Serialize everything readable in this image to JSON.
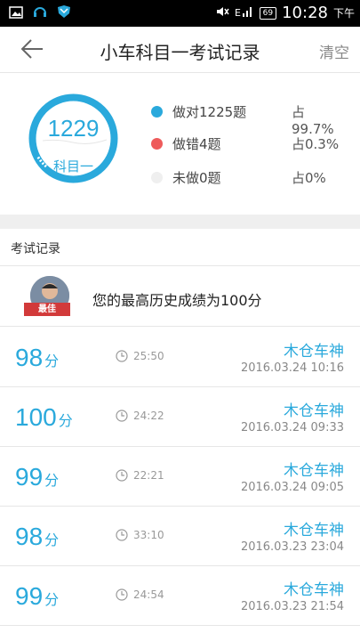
{
  "status_bar": {
    "battery": "69",
    "time": "10:28",
    "ampm": "下午"
  },
  "header": {
    "title": "小车科目一考试记录",
    "clear_label": "清空"
  },
  "summary": {
    "total": "1229",
    "subject": "科目一",
    "legend": [
      {
        "label": "做对1225题",
        "pct": "占99.7%",
        "color": "#2aa9dc"
      },
      {
        "label": "做错4题",
        "pct": "占0.3%",
        "color": "#ee5b5b"
      },
      {
        "label": "未做0题",
        "pct": "占0%",
        "color": "#efefef"
      }
    ]
  },
  "section_title": "考试记录",
  "best": {
    "badge": "最佳",
    "text": "您的最高历史成绩为100分"
  },
  "records": [
    {
      "score": "98",
      "unit": "分",
      "duration": "25:50",
      "user": "木仓车神",
      "date": "2016.03.24  10:16"
    },
    {
      "score": "100",
      "unit": "分",
      "duration": "24:22",
      "user": "木仓车神",
      "date": "2016.03.24  09:33"
    },
    {
      "score": "99",
      "unit": "分",
      "duration": "22:21",
      "user": "木仓车神",
      "date": "2016.03.24  09:05"
    },
    {
      "score": "98",
      "unit": "分",
      "duration": "33:10",
      "user": "木仓车神",
      "date": "2016.03.23  23:04"
    },
    {
      "score": "99",
      "unit": "分",
      "duration": "24:54",
      "user": "木仓车神",
      "date": "2016.03.23  21:54"
    }
  ]
}
